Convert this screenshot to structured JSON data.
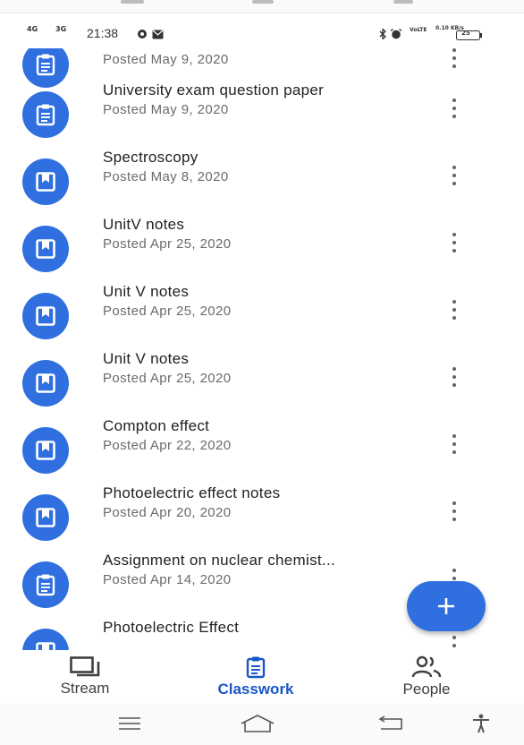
{
  "status_bar": {
    "signal_1": "4G",
    "signal_2": "3G",
    "time": "21:38",
    "network_speed": "0.10 KB/s",
    "battery": "25"
  },
  "classwork_items": [
    {
      "title": "",
      "date": "Posted May 9, 2020",
      "icon": "assignment-icon"
    },
    {
      "title": "University exam question paper",
      "date": "Posted May 9, 2020",
      "icon": "assignment-icon"
    },
    {
      "title": "Spectroscopy",
      "date": "Posted May 8, 2020",
      "icon": "material-icon"
    },
    {
      "title": "UnitV notes",
      "date": "Posted Apr 25, 2020",
      "icon": "material-icon"
    },
    {
      "title": "Unit V notes",
      "date": "Posted Apr 25, 2020",
      "icon": "material-icon"
    },
    {
      "title": "Unit V notes",
      "date": "Posted Apr 25, 2020",
      "icon": "material-icon"
    },
    {
      "title": "Compton effect",
      "date": "Posted Apr 22, 2020",
      "icon": "material-icon"
    },
    {
      "title": "Photoelectric effect notes",
      "date": "Posted Apr 20, 2020",
      "icon": "material-icon"
    },
    {
      "title": "Assignment on nuclear chemist...",
      "date": "Posted Apr 14, 2020",
      "icon": "assignment-icon"
    },
    {
      "title": "Photoelectric Effect",
      "date": "",
      "icon": "material-icon"
    }
  ],
  "fab": {
    "icon": "plus-icon"
  },
  "bottom_nav": {
    "tabs": [
      {
        "label": "Stream",
        "icon": "stream-icon",
        "active": false
      },
      {
        "label": "Classwork",
        "icon": "classwork-icon",
        "active": true
      },
      {
        "label": "People",
        "icon": "people-icon",
        "active": false
      }
    ]
  },
  "system_nav": [
    "menu-icon",
    "home-icon",
    "back-icon",
    "accessibility-icon"
  ],
  "colors": {
    "accent": "#2f6fe0",
    "active_tab": "#1a56c4"
  }
}
